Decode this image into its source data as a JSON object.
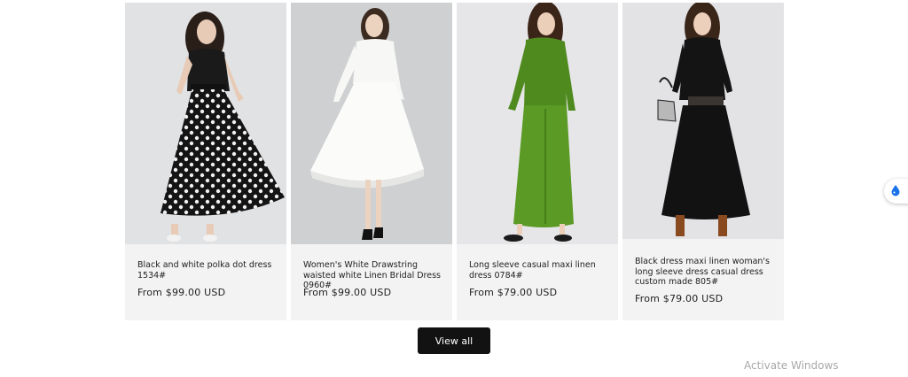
{
  "products": [
    {
      "title": "Black and white polka dot dress 1534#",
      "price": "From $99.00 USD",
      "image_alt": "black-white-polka-dot-dress-photo"
    },
    {
      "title": "Women's White Drawstring waisted white Linen Bridal Dress 0960#",
      "price": "From $99.00 USD",
      "image_alt": "white-linen-bridal-dress-photo"
    },
    {
      "title": "Long sleeve casual maxi linen dress 0784#",
      "price": "From $79.00 USD",
      "image_alt": "green-linen-maxi-dress-photo"
    },
    {
      "title": "Black dress maxi linen woman's long sleeve dress casual dress custom made 805#",
      "price": "From $79.00 USD",
      "image_alt": "black-linen-maxi-dress-photo"
    }
  ],
  "view_all_label": "View all",
  "os_watermark": "Activate Windows",
  "colors": {
    "button_bg": "#121212",
    "card_bg": "#f3f3f3",
    "float_icon": "#1a73e8"
  },
  "icons": {
    "floating_widget": "water-drop-icon"
  }
}
